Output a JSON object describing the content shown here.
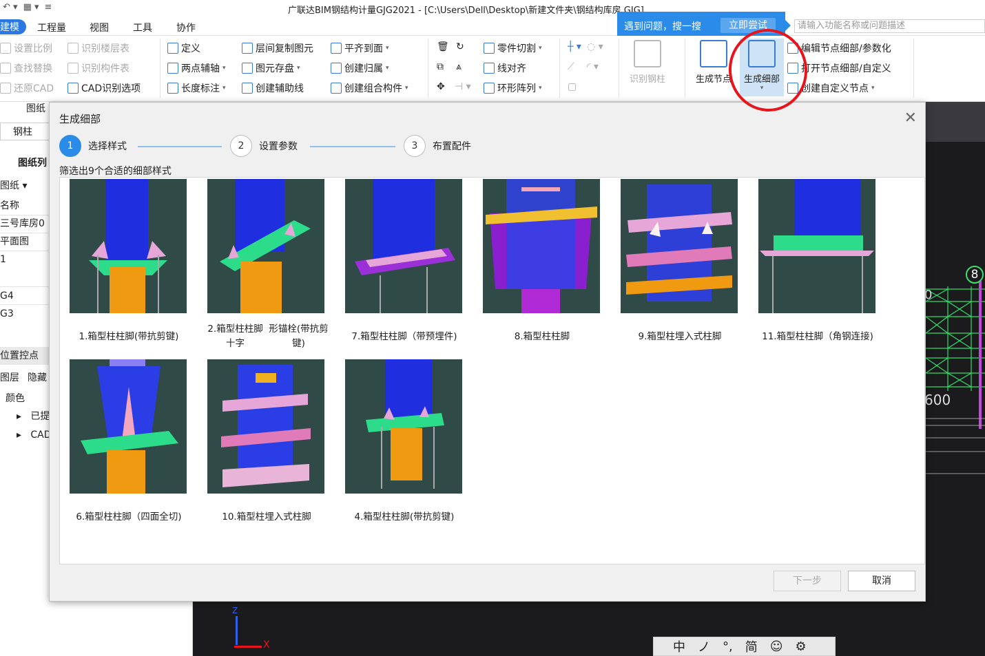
{
  "window": {
    "title": "广联达BIM钢结构计量GJG2021 - [C:\\Users\\Dell\\Desktop\\新建文件夹\\钢结构库房.GJG]"
  },
  "menubar": {
    "items": [
      "建模",
      "工程量",
      "视图",
      "工具",
      "协作"
    ]
  },
  "tip": {
    "text": "遇到问题，搜一搜",
    "button": "立即尝试"
  },
  "search": {
    "placeholder": "请输入功能名称或问题描述"
  },
  "ribbon": {
    "col1": [
      "设置比例",
      "查找替换",
      "还原CAD"
    ],
    "col2": [
      "识别楼层表",
      "识别构件表",
      "CAD识别选项"
    ],
    "col3": [
      "定义",
      "两点辅轴",
      "长度标注"
    ],
    "col4": [
      "层间复制图元",
      "图元存盘",
      "创建辅助线"
    ],
    "col5": [
      "平齐到面",
      "创建归属",
      "创建组合构件"
    ],
    "col7": [
      "零件切割",
      "线对齐",
      "环形阵列"
    ],
    "big": {
      "recognize_column": "识别钢柱",
      "gen_node": "生成节点",
      "gen_detail": "生成细部"
    },
    "node": [
      "编辑节点细部/参数化",
      "打开节点细部/自定义",
      "创建自定义节点"
    ]
  },
  "left_panel": {
    "drawing_tab": "图纸",
    "filter_value": "钢柱",
    "drawing_list_tab": "图纸列",
    "drawing_dropdown": "图纸",
    "name_header": "名称",
    "rows": [
      "三号库房0",
      "平面图",
      "1",
      "G4",
      "G3"
    ],
    "locate_section": "位置控点",
    "layer_tabs": [
      "图层",
      "隐藏"
    ],
    "color_header": "颜色",
    "tree_items": [
      "已提",
      "CAD"
    ]
  },
  "dialog": {
    "title": "生成细部",
    "steps": [
      {
        "num": "1",
        "label": "选择样式"
      },
      {
        "num": "2",
        "label": "设置参数"
      },
      {
        "num": "3",
        "label": "布置配件"
      }
    ],
    "filter_text": "筛选出9个合适的细部样式",
    "items": [
      {
        "line1": "1.箱型柱柱脚(带抗剪键)",
        "line2": ""
      },
      {
        "line1": "2.箱型柱柱脚十字",
        "line2": "形锚栓(带抗剪键)"
      },
      {
        "line1": "7.箱型柱柱",
        "line2": "脚（带预埋件)"
      },
      {
        "line1": "8.箱型柱柱脚",
        "line2": ""
      },
      {
        "line1": "9.箱型柱埋入式柱脚",
        "line2": ""
      },
      {
        "line1": "11.箱型柱柱",
        "line2": "脚（角钢连接)"
      },
      {
        "line1": "6.箱型柱柱",
        "line2": "脚（四面全切)"
      },
      {
        "line1": "10.箱型柱埋入式柱脚",
        "line2": ""
      },
      {
        "line1": "4.箱型柱柱脚(带抗剪键)",
        "line2": ""
      }
    ],
    "next_label": "下一步",
    "cancel_label": "取消"
  },
  "cad": {
    "label_0": "0",
    "label_600": "600",
    "axis_circle": "8",
    "axis_x": "X",
    "axis_z": "Z"
  },
  "ime": {
    "items": [
      "中",
      "ノ",
      "°,",
      "简",
      "☺",
      "⚙"
    ]
  }
}
